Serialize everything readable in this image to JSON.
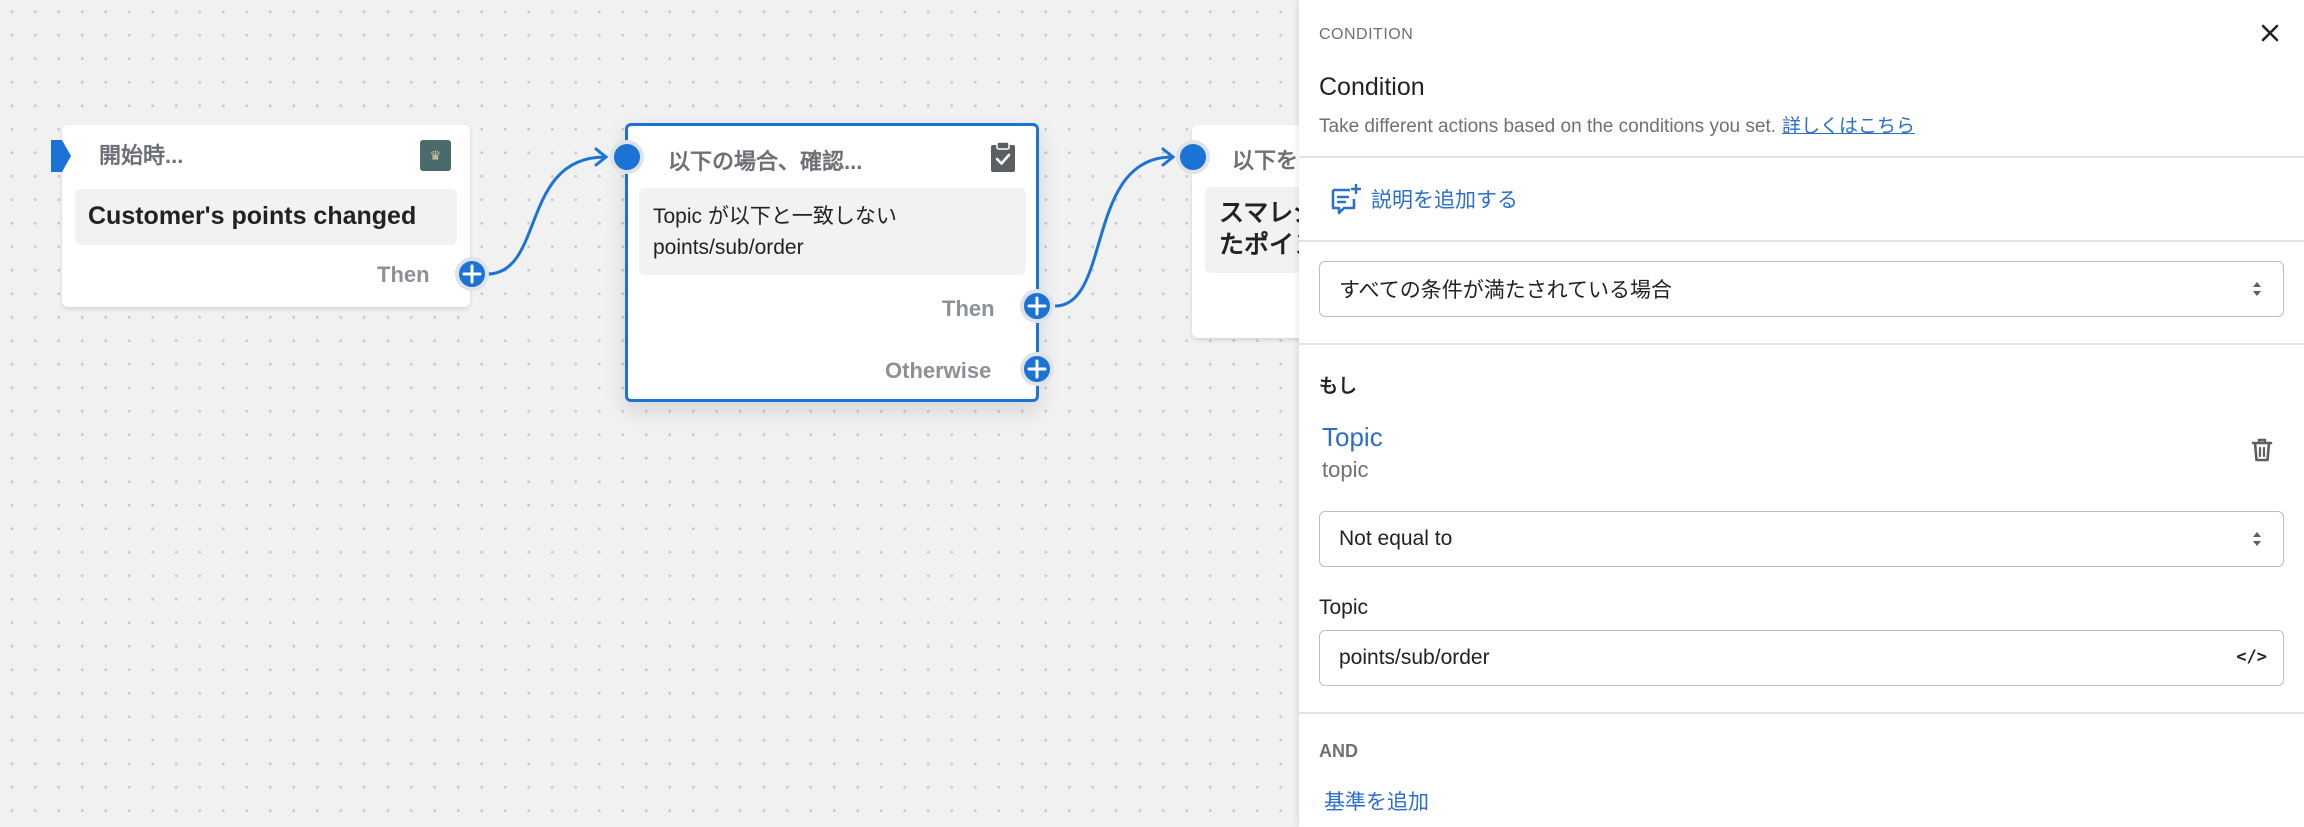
{
  "canvas": {
    "node1": {
      "header": "開始時...",
      "body": "Customer's points changed",
      "then_label": "Then"
    },
    "node2": {
      "header": "以下の場合、確認...",
      "body_line1": "Topic が以下と一致しない",
      "body_line2": "points/sub/order",
      "then_label": "Then",
      "otherwise_label": "Otherwise"
    },
    "node3": {
      "header": "以下を",
      "body_line1": "スマレジ",
      "body_line2": "たポイン"
    }
  },
  "panel": {
    "kicker": "CONDITION",
    "title": "Condition",
    "description": "Take different actions based on the conditions you set.",
    "learn_more": "詳しくはこちら",
    "add_description": "説明を追加する",
    "match_select": "すべての条件が満たされている場合",
    "if_label": "もし",
    "field_title": "Topic",
    "field_sub": "topic",
    "operator_select": "Not equal to",
    "value_label": "Topic",
    "value_input": "points/sub/order",
    "code_toggle": "</>",
    "and_label": "AND",
    "add_criteria": "基準を追加"
  },
  "colors": {
    "accent": "#1b73d6",
    "link": "#2c6ecb",
    "canvas_bg": "#f1f1f2"
  }
}
